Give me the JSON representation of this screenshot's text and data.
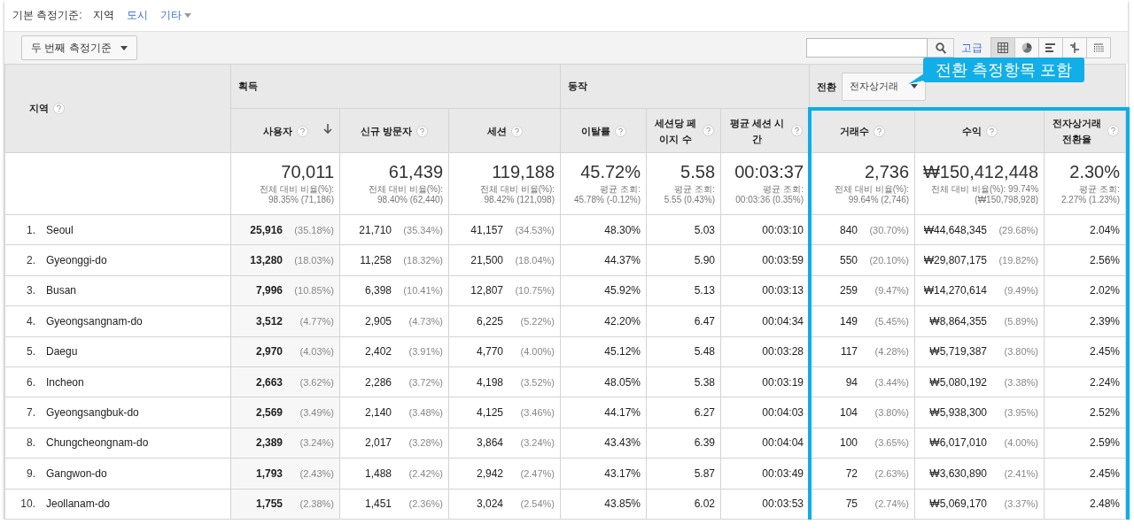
{
  "primary_dimension": {
    "label": "기본 측정기준:",
    "options": [
      {
        "label": "지역",
        "selected": true,
        "kind": "link"
      },
      {
        "label": "도시",
        "selected": false,
        "kind": "link"
      },
      {
        "label": "기타",
        "selected": false,
        "kind": "menu"
      }
    ]
  },
  "toolbar": {
    "secondary_dimension": "두 번째 측정기준",
    "advanced_link": "고급",
    "view_buttons": [
      {
        "kind": "table",
        "selected": true
      },
      {
        "kind": "pie",
        "selected": false
      },
      {
        "kind": "bar",
        "selected": false
      },
      {
        "kind": "compare",
        "selected": false
      },
      {
        "kind": "pivot",
        "selected": false
      }
    ]
  },
  "table": {
    "dimension_column": "지역",
    "groups": [
      {
        "label": "획득",
        "highlighted": false,
        "columns": [
          {
            "label": "사용자",
            "sorted": true
          },
          {
            "label": "신규 방문자",
            "sorted": false
          },
          {
            "label": "세션",
            "sorted": false
          }
        ]
      },
      {
        "label": "동작",
        "highlighted": false,
        "columns": [
          {
            "label": "이탈률",
            "sorted": false
          },
          {
            "label": "세션당 페이지 수",
            "sorted": false
          },
          {
            "label": "평균 세션 시간",
            "sorted": false
          }
        ]
      },
      {
        "label": "전환",
        "dropdown": "전자상거래",
        "highlighted": true,
        "callout": "전환 측정항목 포함",
        "columns": [
          {
            "label": "거래수",
            "sorted": false
          },
          {
            "label": "수익",
            "sorted": false
          },
          {
            "label": "전자상거래 전환율",
            "sorted": false
          }
        ]
      }
    ],
    "totals": [
      {
        "value": "70,011",
        "note": [
          "전체 대비 비율(%):",
          "98.35% (71,186)"
        ]
      },
      {
        "value": "61,439",
        "note": [
          "전체 대비 비율(%):",
          "98.40% (62,440)"
        ]
      },
      {
        "value": "119,188",
        "note": [
          "전체 대비 비율(%):",
          "98.42% (121,098)"
        ]
      },
      {
        "value": "45.72%",
        "note": [
          "평균 조회:",
          "45.78% (-0.12%)"
        ]
      },
      {
        "value": "5.58",
        "note": [
          "평균 조회:",
          "5.55 (0.43%)"
        ]
      },
      {
        "value": "00:03:37",
        "note": [
          "평균 조회:",
          "00:03:36 (0.35%)"
        ]
      },
      {
        "value": "2,736",
        "note": [
          "전체 대비 비율(%):",
          "99.64% (2,746)"
        ]
      },
      {
        "value": "₩150,412,448",
        "note": [
          "전체 대비 비율(%): 99.74%",
          "(₩150,798,928)"
        ]
      },
      {
        "value": "2.30%",
        "note": [
          "평균 조회:",
          "2.27% (1.23%)"
        ]
      }
    ],
    "rows": [
      {
        "index": "1.",
        "name": "Seoul",
        "cells": [
          {
            "value": "25,916",
            "share": "(35.18%)"
          },
          {
            "value": "21,710",
            "share": "(35.34%)"
          },
          {
            "value": "41,157",
            "share": "(34.53%)"
          },
          {
            "value": "48.30%"
          },
          {
            "value": "5.03"
          },
          {
            "value": "00:03:10"
          },
          {
            "value": "840",
            "share": "(30.70%)"
          },
          {
            "value": "₩44,648,345",
            "share": "(29.68%)"
          },
          {
            "value": "2.04%"
          }
        ]
      },
      {
        "index": "2.",
        "name": "Gyeonggi-do",
        "cells": [
          {
            "value": "13,280",
            "share": "(18.03%)"
          },
          {
            "value": "11,258",
            "share": "(18.32%)"
          },
          {
            "value": "21,500",
            "share": "(18.04%)"
          },
          {
            "value": "44.37%"
          },
          {
            "value": "5.90"
          },
          {
            "value": "00:03:59"
          },
          {
            "value": "550",
            "share": "(20.10%)"
          },
          {
            "value": "₩29,807,175",
            "share": "(19.82%)"
          },
          {
            "value": "2.56%"
          }
        ]
      },
      {
        "index": "3.",
        "name": "Busan",
        "cells": [
          {
            "value": "7,996",
            "share": "(10.85%)"
          },
          {
            "value": "6,398",
            "share": "(10.41%)"
          },
          {
            "value": "12,807",
            "share": "(10.75%)"
          },
          {
            "value": "45.92%"
          },
          {
            "value": "5.13"
          },
          {
            "value": "00:03:13"
          },
          {
            "value": "259",
            "share": "(9.47%)"
          },
          {
            "value": "₩14,270,614",
            "share": "(9.49%)"
          },
          {
            "value": "2.02%"
          }
        ]
      },
      {
        "index": "4.",
        "name": "Gyeongsangnam-do",
        "cells": [
          {
            "value": "3,512",
            "share": "(4.77%)"
          },
          {
            "value": "2,905",
            "share": "(4.73%)"
          },
          {
            "value": "6,225",
            "share": "(5.22%)"
          },
          {
            "value": "42.20%"
          },
          {
            "value": "6.47"
          },
          {
            "value": "00:04:34"
          },
          {
            "value": "149",
            "share": "(5.45%)"
          },
          {
            "value": "₩8,864,355",
            "share": "(5.89%)"
          },
          {
            "value": "2.39%"
          }
        ]
      },
      {
        "index": "5.",
        "name": "Daegu",
        "cells": [
          {
            "value": "2,970",
            "share": "(4.03%)"
          },
          {
            "value": "2,402",
            "share": "(3.91%)"
          },
          {
            "value": "4,770",
            "share": "(4.00%)"
          },
          {
            "value": "45.12%"
          },
          {
            "value": "5.48"
          },
          {
            "value": "00:03:28"
          },
          {
            "value": "117",
            "share": "(4.28%)"
          },
          {
            "value": "₩5,719,387",
            "share": "(3.80%)"
          },
          {
            "value": "2.45%"
          }
        ]
      },
      {
        "index": "6.",
        "name": "Incheon",
        "cells": [
          {
            "value": "2,663",
            "share": "(3.62%)"
          },
          {
            "value": "2,286",
            "share": "(3.72%)"
          },
          {
            "value": "4,198",
            "share": "(3.52%)"
          },
          {
            "value": "48.05%"
          },
          {
            "value": "5.38"
          },
          {
            "value": "00:03:19"
          },
          {
            "value": "94",
            "share": "(3.44%)"
          },
          {
            "value": "₩5,080,192",
            "share": "(3.38%)"
          },
          {
            "value": "2.24%"
          }
        ]
      },
      {
        "index": "7.",
        "name": "Gyeongsangbuk-do",
        "cells": [
          {
            "value": "2,569",
            "share": "(3.49%)"
          },
          {
            "value": "2,140",
            "share": "(3.48%)"
          },
          {
            "value": "4,125",
            "share": "(3.46%)"
          },
          {
            "value": "44.17%"
          },
          {
            "value": "6.27"
          },
          {
            "value": "00:04:03"
          },
          {
            "value": "104",
            "share": "(3.80%)"
          },
          {
            "value": "₩5,938,300",
            "share": "(3.95%)"
          },
          {
            "value": "2.52%"
          }
        ]
      },
      {
        "index": "8.",
        "name": "Chungcheongnam-do",
        "cells": [
          {
            "value": "2,389",
            "share": "(3.24%)"
          },
          {
            "value": "2,017",
            "share": "(3.28%)"
          },
          {
            "value": "3,864",
            "share": "(3.24%)"
          },
          {
            "value": "43.43%"
          },
          {
            "value": "6.39"
          },
          {
            "value": "00:04:04"
          },
          {
            "value": "100",
            "share": "(3.65%)"
          },
          {
            "value": "₩6,017,010",
            "share": "(4.00%)"
          },
          {
            "value": "2.59%"
          }
        ]
      },
      {
        "index": "9.",
        "name": "Gangwon-do",
        "cells": [
          {
            "value": "1,793",
            "share": "(2.43%)"
          },
          {
            "value": "1,488",
            "share": "(2.42%)"
          },
          {
            "value": "2,942",
            "share": "(2.47%)"
          },
          {
            "value": "43.17%"
          },
          {
            "value": "5.87"
          },
          {
            "value": "00:03:49"
          },
          {
            "value": "72",
            "share": "(2.63%)"
          },
          {
            "value": "₩3,630,890",
            "share": "(2.41%)"
          },
          {
            "value": "2.45%"
          }
        ]
      },
      {
        "index": "10.",
        "name": "Jeollanam-do",
        "cells": [
          {
            "value": "1,755",
            "share": "(2.38%)"
          },
          {
            "value": "1,451",
            "share": "(2.36%)"
          },
          {
            "value": "3,024",
            "share": "(2.54%)"
          },
          {
            "value": "43.85%"
          },
          {
            "value": "6.02"
          },
          {
            "value": "00:03:53"
          },
          {
            "value": "75",
            "share": "(2.74%)"
          },
          {
            "value": "₩5,069,170",
            "share": "(3.37%)"
          },
          {
            "value": "2.48%"
          }
        ]
      }
    ]
  }
}
